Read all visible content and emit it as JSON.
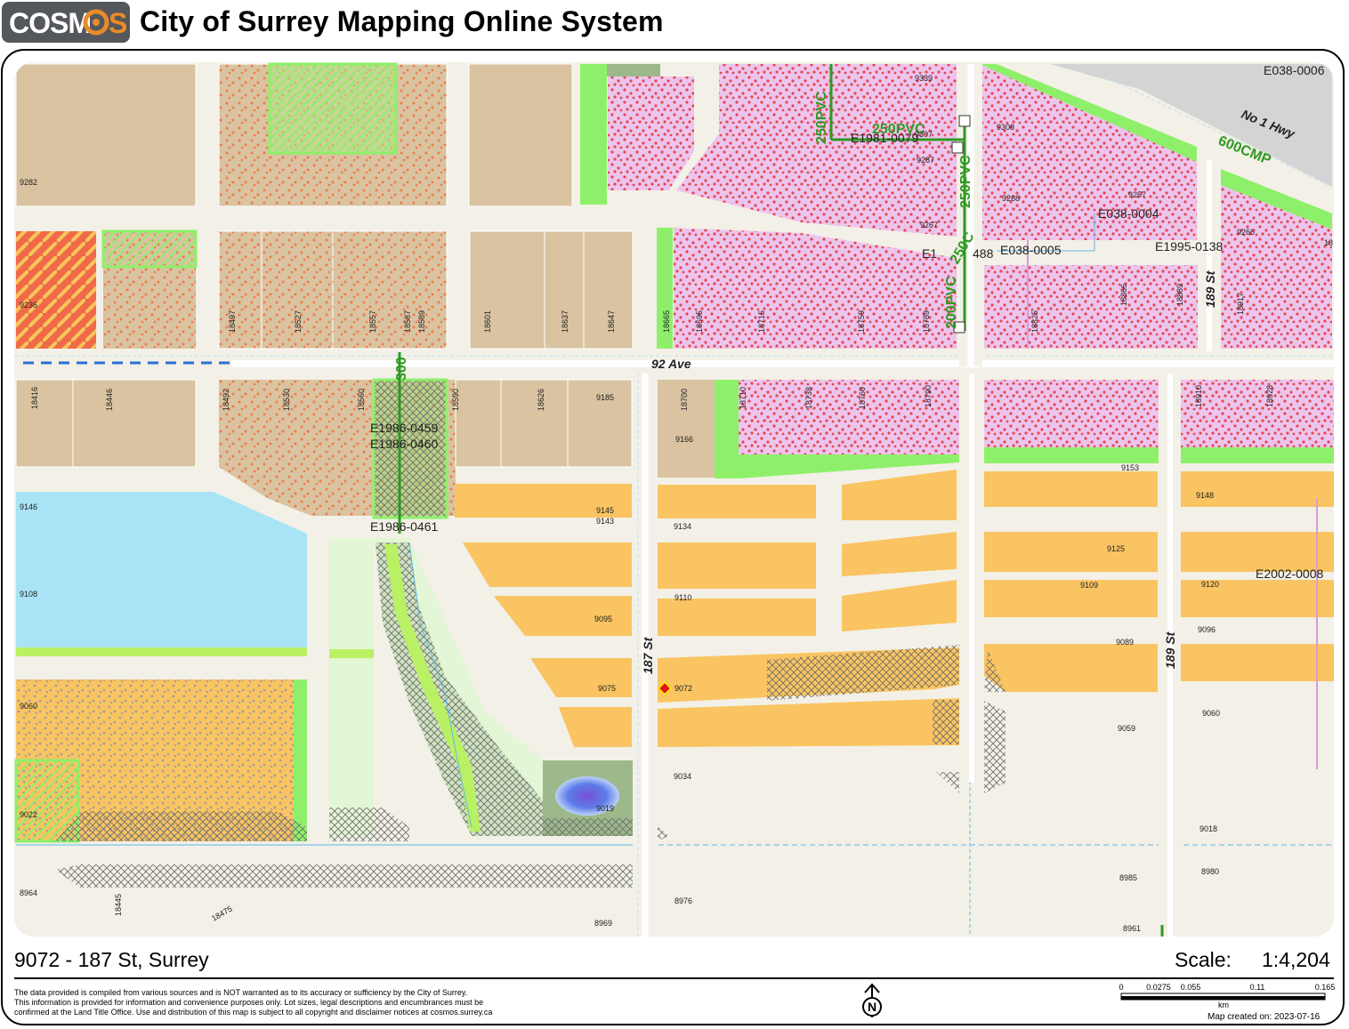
{
  "header": {
    "logo_text": "COSMOS",
    "title": "City of Surrey Mapping Online System"
  },
  "map": {
    "streets": {
      "avenue_92": "92 Ave",
      "street_187": "187 St",
      "street_189_north": "189 St",
      "street_189_south": "189 St",
      "highway": "No 1 Hwy"
    },
    "pipes": {
      "p250_a": "250PVC",
      "p250_b": "250PVC",
      "p250_c": "250PVC",
      "p250_d": "250C",
      "p200": "200PVC",
      "p600": "600CMP",
      "p300": "300"
    },
    "easements": {
      "e1": "E038-0006",
      "e2": "E1981-0079",
      "e3": "E038-0004",
      "e4": "E038-0005",
      "e5": "E1995-0138",
      "e6": "E1986-0459",
      "e7": "E1986-0460",
      "e8": "E1986-0461",
      "e9": "E2002-0008",
      "e10": "E1",
      "e11": "488"
    },
    "addresses": {
      "a9282": "9282",
      "a9236": "9236",
      "a18497": "18497",
      "a18527": "18527",
      "a18557": "18557",
      "a18587": "18587",
      "a18589": "18589",
      "a18601": "18601",
      "a18637": "18637",
      "a18647": "18647",
      "a18665": "18665",
      "a18695": "18695",
      "a18715": "18715",
      "a18759": "18759",
      "a18789": "18789",
      "a18825": "18825",
      "a18866": "18866",
      "a18889": "18889",
      "a18917": "18917",
      "a9339": "9339",
      "a9307": "9307",
      "a9287": "9287",
      "a9267": "9267",
      "a9308": "9308",
      "a9268": "9268",
      "a9257": "9257",
      "a9266": "9266",
      "a18b": "18",
      "a18416": "18416",
      "a18446": "18446",
      "a18492": "18492",
      "a18530": "18530",
      "a18560": "18560",
      "a18590": "18590",
      "a18626": "18626",
      "a9185": "9185",
      "a18700": "18700",
      "a18710": "18710",
      "a18738": "18738",
      "a18760": "18760",
      "a18790": "18790",
      "a18910": "18910",
      "a18928": "18928",
      "a9166": "9166",
      "a9153": "9153",
      "a9148": "9148",
      "a9146": "9146",
      "a9145": "9145",
      "a9143": "9143",
      "a9134": "9134",
      "a9125": "9125",
      "a9109": "9109",
      "a9120": "9120",
      "a9108": "9108",
      "a9110": "9110",
      "a9095": "9095",
      "a9096": "9096",
      "a9089": "9089",
      "a9075": "9075",
      "a9072": "9072",
      "a9060a": "9060",
      "a9060b": "9060",
      "a9059": "9059",
      "a9034": "9034",
      "a9019": "9019",
      "a9022": "9022",
      "a9018": "9018",
      "a8964": "8964",
      "a18445": "18445",
      "a18475": "18475",
      "a8976": "8976",
      "a8969": "8969",
      "a8985": "8985",
      "a8980": "8980",
      "a8961": "8961"
    },
    "colors": {
      "parcel_tan": "#d9c3a0",
      "parcel_orange": "#f9c461",
      "residential_pink": "#ecc5ee",
      "greenbelt": "#8ef06a",
      "water": "#a9e4f6",
      "road": "#f3f0e7",
      "pipe_green": "#2f9a22",
      "subject_marker": "#e0141c"
    }
  },
  "footer": {
    "address": "9072 - 187 St, Surrey",
    "scale_label": "Scale:",
    "scale_value": "1:4,204",
    "disclaimer": "The data provided is compiled from various sources and is NOT warranted as to its accuracy or sufficiency by the City of Surrey.\nThis information is provided for information and convenience purposes only.  Lot sizes, legal descriptions and encumbrances must be\nconfirmed at the Land Title Office.  Use and distribution of this map is subject to all copyright and disclaimer notices at cosmos.surrey.ca",
    "north_label": "N",
    "scalebar": {
      "t0": "0",
      "t1": "0.0275",
      "t2": "0.055",
      "t3": "0.11",
      "t4": "0.165",
      "unit": "km"
    },
    "created": "Map created on: 2023-07-16"
  }
}
